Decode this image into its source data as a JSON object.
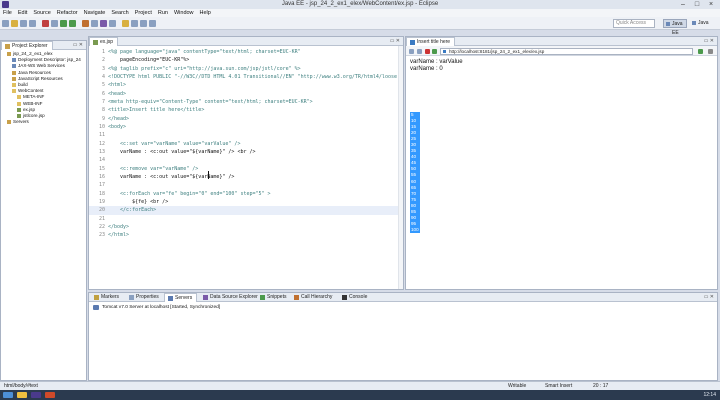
{
  "window": {
    "title": "Java EE - jsp_24_2_ex1_elex/WebContent/ex.jsp - Eclipse"
  },
  "menu": [
    "File",
    "Edit",
    "Source",
    "Refactor",
    "Navigate",
    "Search",
    "Project",
    "Run",
    "Window",
    "Help"
  ],
  "toolbar": {
    "quick_access_placeholder": "Quick Access",
    "perspective_active": "Java EE",
    "perspective_other": "Java"
  },
  "explorer": {
    "tab_label": "Project Explorer",
    "items": [
      {
        "label": "jsp_24_2_ex1_elex",
        "depth": 0,
        "color": "#c8a04a"
      },
      {
        "label": "Deployment Descriptor: jsp_24",
        "depth": 1,
        "color": "#6b89b8"
      },
      {
        "label": "JAX-WS Web Services",
        "depth": 1,
        "color": "#6b89b8"
      },
      {
        "label": "Java Resources",
        "depth": 1,
        "color": "#c8a04a"
      },
      {
        "label": "JavaScript Resources",
        "depth": 1,
        "color": "#c8a04a"
      },
      {
        "label": "build",
        "depth": 1,
        "color": "#e0c060"
      },
      {
        "label": "WebContent",
        "depth": 1,
        "color": "#e0c060"
      },
      {
        "label": "META-INF",
        "depth": 2,
        "color": "#e0c060"
      },
      {
        "label": "WEB-INF",
        "depth": 2,
        "color": "#e0c060"
      },
      {
        "label": "ex.jsp",
        "depth": 2,
        "color": "#7a9a50"
      },
      {
        "label": "jstlcore.jsp",
        "depth": 2,
        "color": "#7a9a50"
      },
      {
        "label": "Servers",
        "depth": 0,
        "color": "#c8a04a"
      }
    ]
  },
  "editor": {
    "tab_label": "ex.jsp",
    "current_line": 20,
    "lines": [
      {
        "n": "1",
        "text": "<%@ page language=\"java\" contentType=\"text/html; charset=EUC-KR\""
      },
      {
        "n": "2",
        "text": "    pageEncoding=\"EUC-KR\"%>"
      },
      {
        "n": "3",
        "text": "<%@ taglib prefix=\"c\" uri=\"http://java.sun.com/jsp/jstl/core\" %>"
      },
      {
        "n": "4",
        "text": "<!DOCTYPE html PUBLIC \"-//W3C//DTD HTML 4.01 Transitional//EN\" \"http://www.w3.org/TR/html4/loose"
      },
      {
        "n": "5",
        "text": "<html>"
      },
      {
        "n": "6",
        "text": "<head>"
      },
      {
        "n": "7",
        "text": "<meta http-equiv=\"Content-Type\" content=\"text/html; charset=EUC-KR\">"
      },
      {
        "n": "8",
        "text": "<title>Insert title here</title>"
      },
      {
        "n": "9",
        "text": "</head>"
      },
      {
        "n": "10",
        "text": "<body>"
      },
      {
        "n": "11",
        "text": ""
      },
      {
        "n": "12",
        "text": "    <c:set var=\"varName\" value=\"varValue\" />"
      },
      {
        "n": "13",
        "text": "    varName : <c:out value=\"${varName}\" /> <br />"
      },
      {
        "n": "14",
        "text": ""
      },
      {
        "n": "15",
        "text": "    <c:remove var=\"varName\" />"
      },
      {
        "n": "16",
        "text": "    varName : <c:out value=\"${varName}\" />"
      },
      {
        "n": "17",
        "text": ""
      },
      {
        "n": "18",
        "text": "    <c:forEach var=\"fe\" begin=\"0\" end=\"100\" step=\"5\" >"
      },
      {
        "n": "19",
        "text": "        ${fe} <br />"
      },
      {
        "n": "20",
        "text": "    </c:forEach>"
      },
      {
        "n": "21",
        "text": ""
      },
      {
        "n": "22",
        "text": "</body>"
      },
      {
        "n": "23",
        "text": "</html>"
      }
    ]
  },
  "browser": {
    "tab_label": "Insert title here",
    "url": "http://localhost:8181/jsp_24_2_ex1_elex/ex.jsp",
    "output": [
      "varName : varValue",
      "varName : 0"
    ],
    "selected_values": [
      "5",
      "10",
      "15",
      "20",
      "25",
      "30",
      "35",
      "40",
      "45",
      "50",
      "55",
      "60",
      "65",
      "70",
      "75",
      "80",
      "85",
      "90",
      "95",
      "100"
    ]
  },
  "bottom": {
    "tabs": [
      "Markers",
      "Properties",
      "Servers",
      "Data Source Explorer",
      "Snippets",
      "Call Hierarchy",
      "Console"
    ],
    "active_tab": "Servers",
    "server_entry": "Tomcat v7.0 Server at localhost  [Started, Synchronized]"
  },
  "status": {
    "path": "html/body/#text",
    "writable": "Writable",
    "insert_mode": "Smart Insert",
    "position": "20 : 17"
  },
  "taskbar": {
    "clock": "12:14"
  }
}
